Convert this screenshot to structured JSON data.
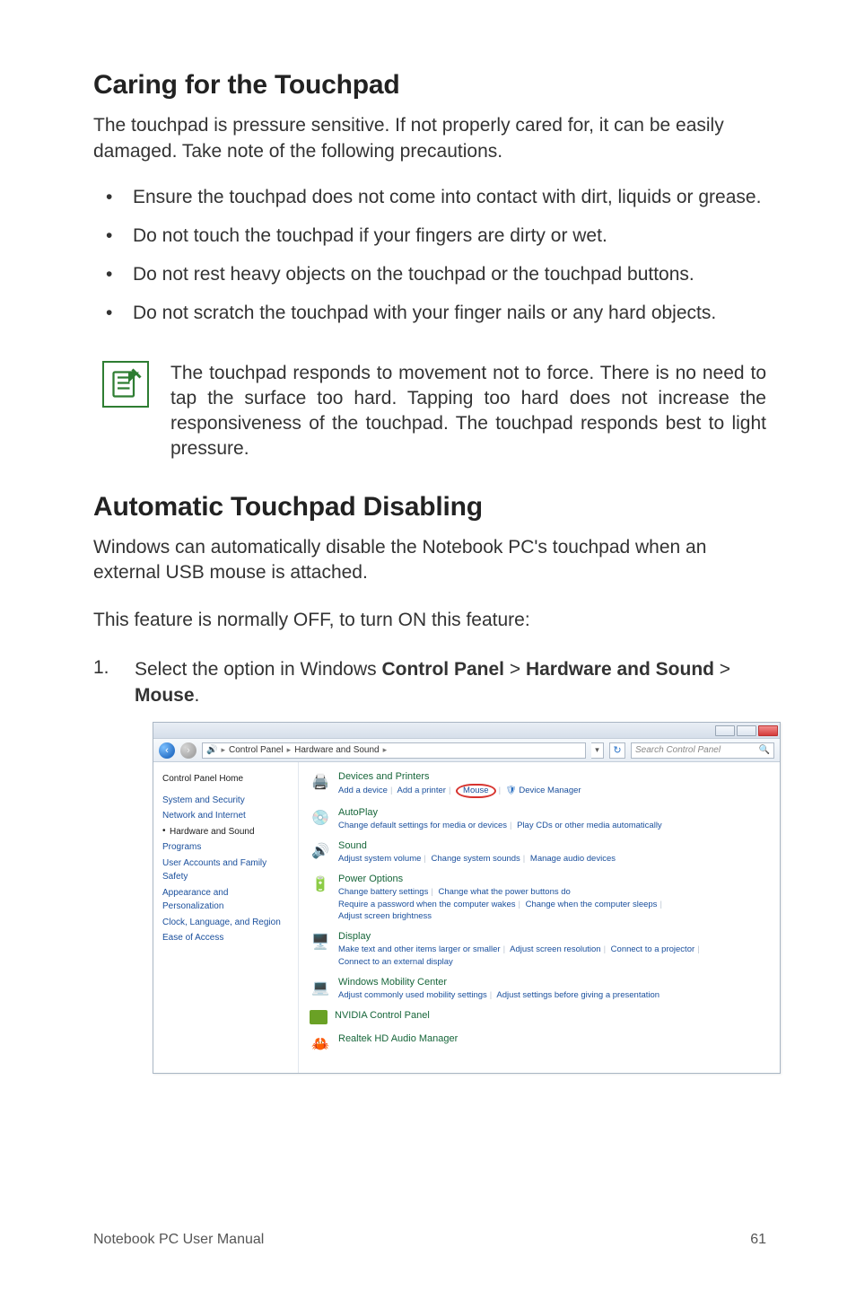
{
  "section1": {
    "heading": "Caring for the Touchpad",
    "intro": "The touchpad is pressure sensitive. If not properly cared for, it can be easily damaged. Take note of the following precautions.",
    "bullets": [
      "Ensure the touchpad does not come into contact with dirt, liquids or grease.",
      "Do not touch the touchpad if your fingers are dirty or wet.",
      "Do not rest heavy objects on the touchpad or the touchpad buttons.",
      "Do not scratch the touchpad with your finger nails or any hard objects."
    ],
    "note": "The touchpad responds to movement not to force. There is no need to tap the surface too hard. Tapping too hard does not increase the responsiveness of the touchpad. The touchpad responds best to light pressure."
  },
  "section2": {
    "heading": "Automatic Touchpad Disabling",
    "p1": "Windows can automatically disable the Notebook PC's touchpad when an external USB mouse is attached.",
    "p2": "This feature is normally OFF, to turn ON this feature:",
    "step1": {
      "num": "1.",
      "pre": "Select the option in Windows ",
      "b1": "Control Panel",
      "gt1": " > ",
      "b2": "Hardware and Sound",
      "gt2": " > ",
      "b3": "Mouse",
      "post": "."
    }
  },
  "cp": {
    "breadcrumb": {
      "c1": "Control Panel",
      "c2": "Hardware and Sound"
    },
    "search_placeholder": "Search Control Panel",
    "side": {
      "home": "Control Panel Home",
      "items": [
        "System and Security",
        "Network and Internet",
        "Hardware and Sound",
        "Programs",
        "User Accounts and Family Safety",
        "Appearance and Personalization",
        "Clock, Language, and Region",
        "Ease of Access"
      ]
    },
    "cats": {
      "devices": {
        "title": "Devices and Printers",
        "l1": "Add a device",
        "l2": "Add a printer",
        "mouse": "Mouse",
        "l3": "Device Manager"
      },
      "autoplay": {
        "title": "AutoPlay",
        "l1": "Change default settings for media or devices",
        "l2": "Play CDs or other media automatically"
      },
      "sound": {
        "title": "Sound",
        "l1": "Adjust system volume",
        "l2": "Change system sounds",
        "l3": "Manage audio devices"
      },
      "power": {
        "title": "Power Options",
        "l1": "Change battery settings",
        "l2": "Change what the power buttons do",
        "l3": "Require a password when the computer wakes",
        "l4": "Change when the computer sleeps",
        "l5": "Adjust screen brightness"
      },
      "display": {
        "title": "Display",
        "l1": "Make text and other items larger or smaller",
        "l2": "Adjust screen resolution",
        "l3": "Connect to a projector",
        "l4": "Connect to an external display"
      },
      "mobility": {
        "title": "Windows Mobility Center",
        "l1": "Adjust commonly used mobility settings",
        "l2": "Adjust settings before giving a presentation"
      },
      "nvidia": {
        "title": "NVIDIA Control Panel"
      },
      "realtek": {
        "title": "Realtek HD Audio Manager"
      }
    }
  },
  "footer": {
    "left": "Notebook PC User Manual",
    "right": "61"
  }
}
